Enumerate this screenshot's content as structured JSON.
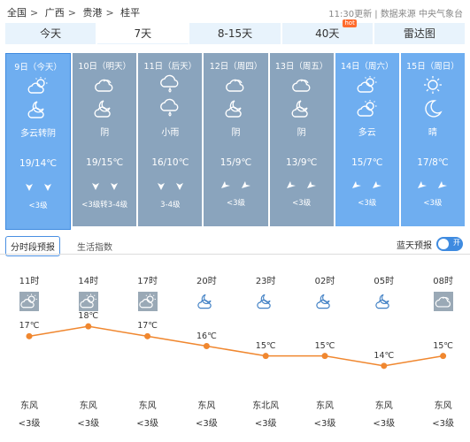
{
  "breadcrumb": [
    "全国",
    "广西",
    "贵港",
    "桂平"
  ],
  "meta": {
    "updated": "11:30更新",
    "source": "数据来源 中央气象台"
  },
  "tabs": [
    {
      "label": "今天",
      "active": false
    },
    {
      "label": "7天",
      "active": true
    },
    {
      "label": "8-15天",
      "active": false
    },
    {
      "label": "40天",
      "active": false,
      "badge": "hot"
    },
    {
      "label": "雷达图",
      "active": false
    }
  ],
  "days": [
    {
      "date": "9日（今天）",
      "icons": [
        "partly-cloudy-icon",
        "cloudy-night-icon"
      ],
      "cond": "多云转阴",
      "temp": "19/14℃",
      "level": "<3级",
      "color": "#6faef0",
      "selected": true
    },
    {
      "date": "10日（明天）",
      "icons": [
        "cloudy-icon",
        "cloudy-night-icon"
      ],
      "cond": "阴",
      "temp": "19/15℃",
      "level": "<3级转3-4级",
      "color": "#8aa4bd"
    },
    {
      "date": "11日（后天）",
      "icons": [
        "rain-icon",
        "rain-icon"
      ],
      "cond": "小雨",
      "temp": "16/10℃",
      "level": "3-4级",
      "color": "#8aa4bd"
    },
    {
      "date": "12日（周四）",
      "icons": [
        "cloudy-icon",
        "cloudy-night-icon"
      ],
      "cond": "阴",
      "temp": "15/9℃",
      "level": "<3级",
      "color": "#8aa4bd"
    },
    {
      "date": "13日（周五）",
      "icons": [
        "cloudy-icon",
        "cloudy-night-icon"
      ],
      "cond": "阴",
      "temp": "13/9℃",
      "level": "<3级",
      "color": "#8aa4bd"
    },
    {
      "date": "14日（周六）",
      "icons": [
        "partly-cloudy-icon",
        "partly-cloudy-icon"
      ],
      "cond": "多云",
      "temp": "15/7℃",
      "level": "<3级",
      "color": "#6faef0"
    },
    {
      "date": "15日（周日）",
      "icons": [
        "sun-icon",
        "moon-icon"
      ],
      "cond": "晴",
      "temp": "17/8℃",
      "level": "<3级",
      "color": "#6faef0"
    }
  ],
  "subtabs": [
    {
      "label": "分时段预报",
      "active": true
    },
    {
      "label": "生活指数",
      "active": false
    }
  ],
  "toggle": {
    "label": "蓝天预报",
    "state": "开"
  },
  "hourly": [
    {
      "time": "11时",
      "icon": "partly-cloudy-icon",
      "temp": 17,
      "wind": "东风",
      "level": "<3级"
    },
    {
      "time": "14时",
      "icon": "partly-cloudy-icon",
      "temp": 18,
      "wind": "东风",
      "level": "<3级"
    },
    {
      "time": "17时",
      "icon": "partly-cloudy-icon",
      "temp": 17,
      "wind": "东风",
      "level": "<3级"
    },
    {
      "time": "20时",
      "icon": "cloudy-night-icon",
      "temp": 16,
      "wind": "东风",
      "level": "<3级"
    },
    {
      "time": "23时",
      "icon": "cloudy-night-icon",
      "temp": 15,
      "wind": "东北风",
      "level": "<3级"
    },
    {
      "time": "02时",
      "icon": "cloudy-night-icon",
      "temp": 15,
      "wind": "东风",
      "level": "<3级"
    },
    {
      "time": "05时",
      "icon": "cloudy-night-icon",
      "temp": 14,
      "wind": "东风",
      "level": "<3级"
    },
    {
      "time": "08时",
      "icon": "cloudy-icon",
      "temp": 15,
      "wind": "东风",
      "level": "<3级"
    }
  ],
  "hourly_temp_labels": [
    "17℃",
    "18℃",
    "17℃",
    "16℃",
    "15℃",
    "15℃",
    "14℃",
    "15℃"
  ],
  "colors": {
    "accent": "#3f8be0",
    "line": "#f0872f",
    "active_day": "#6faef0",
    "inactive_day": "#8aa4bd"
  }
}
